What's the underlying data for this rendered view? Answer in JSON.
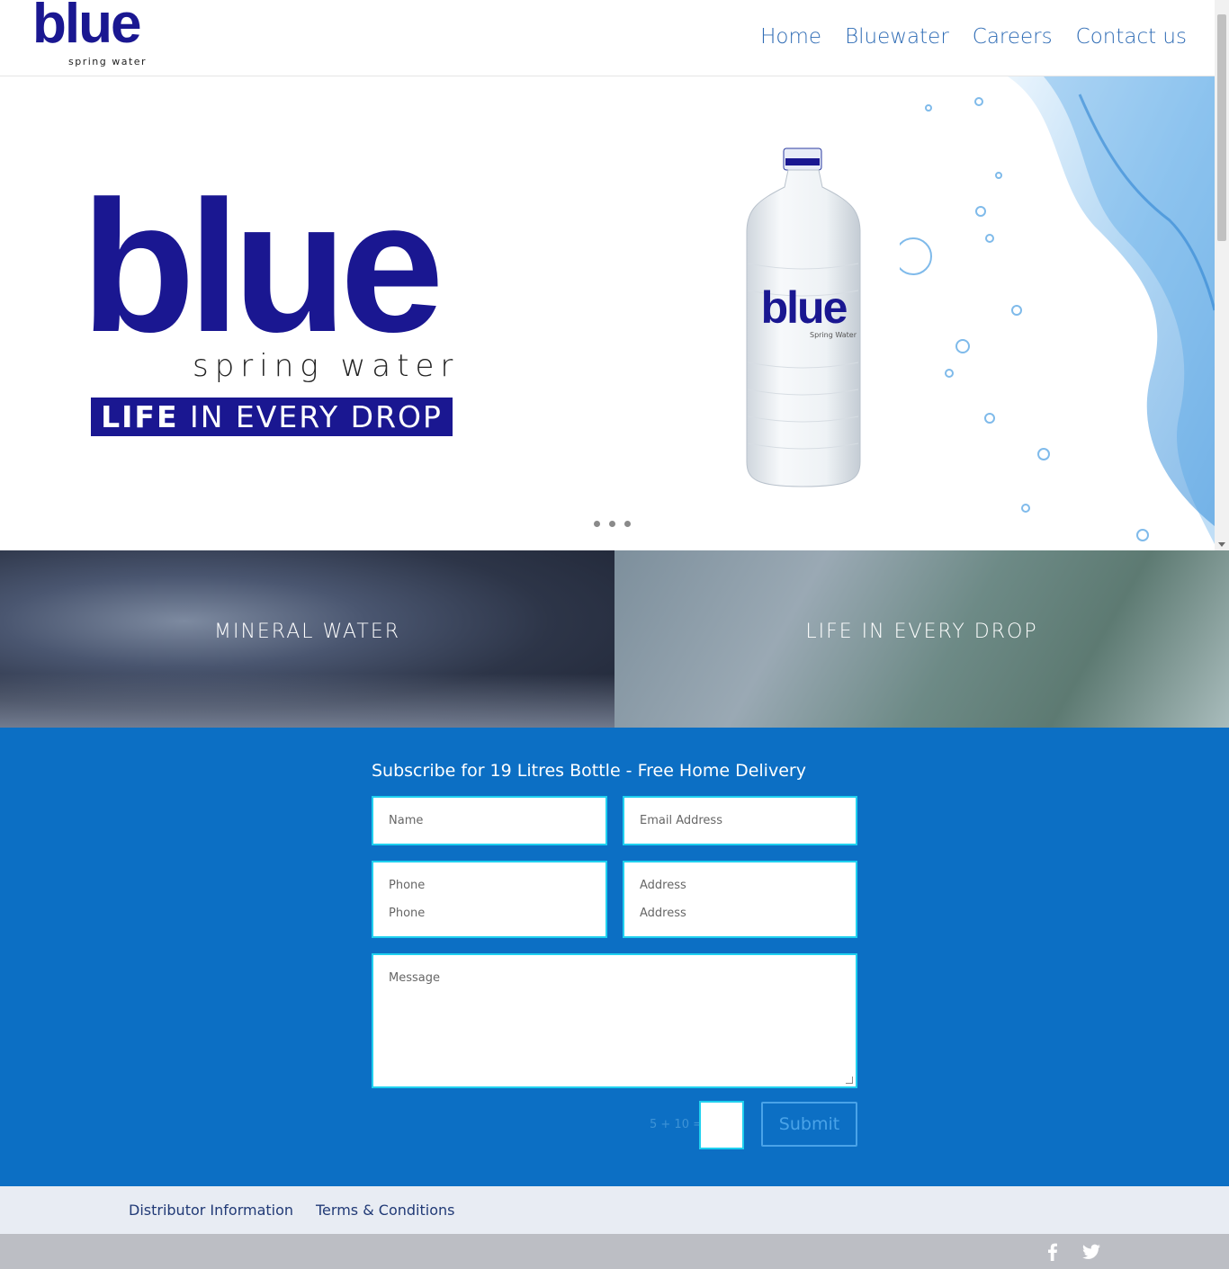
{
  "header": {
    "logo_word": "blue",
    "logo_sub": "spring water",
    "nav": [
      "Home",
      "Bluewater",
      "Careers",
      "Contact us"
    ]
  },
  "hero": {
    "word": "blue",
    "sub": "spring water",
    "tag_bold": "LIFE",
    "tag_rest": " IN EVERY DROP",
    "bottle_label": "blue",
    "bottle_sub": "Spring Water",
    "slides": 3
  },
  "tiles": [
    {
      "label": "MINERAL WATER"
    },
    {
      "label": "LIFE IN EVERY DROP"
    }
  ],
  "form": {
    "title": "Subscribe for 19 Litres Bottle - Free Home Delivery",
    "name_placeholder": "Name",
    "email_placeholder": "Email Address",
    "phone_label": "Phone",
    "phone_placeholder": "Phone",
    "address_label": "Address",
    "address_placeholder": "Address",
    "message_placeholder": "Message",
    "captcha": "5 + 10 =",
    "submit_label": "Submit"
  },
  "footer": {
    "links": [
      "Distributor Information",
      "Terms & Conditions"
    ],
    "social": [
      "facebook-icon",
      "twitter-icon"
    ]
  },
  "colors": {
    "brand": "#1a1791",
    "nav": "#2f6cb5",
    "form_bg": "#0c6fc4",
    "field_border": "#1fd0ef"
  }
}
